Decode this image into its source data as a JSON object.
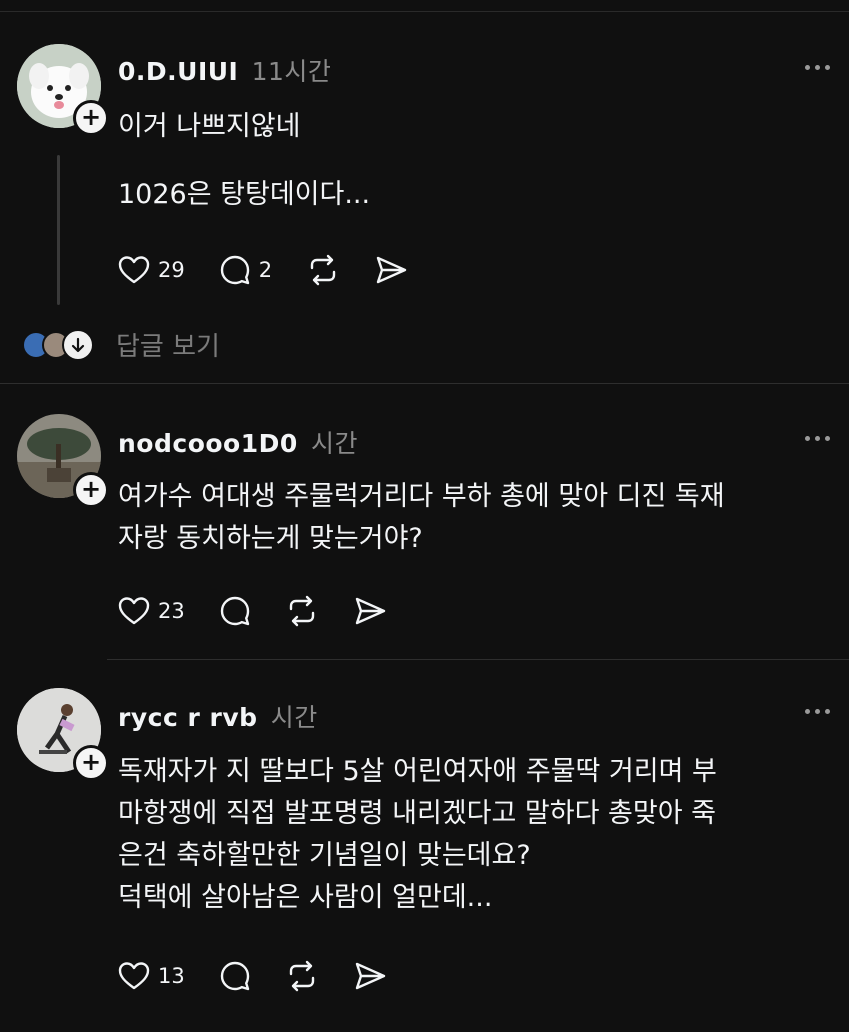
{
  "posts": [
    {
      "username": "0.D.UIUI",
      "time": "11시간",
      "lines": [
        "이거 나쁘지않네",
        "",
        "1026은 탕탕데이다..."
      ],
      "likes": "29",
      "comments": "2",
      "view_replies": "답글 보기"
    },
    {
      "username": "nodcooo1D0",
      "time": "시간",
      "lines": [
        "여가수 여대생 주물럭거리다 부하 총에 맞아 디진 독재",
        "자랑 동치하는게 맞는거야?"
      ],
      "likes": "23"
    },
    {
      "username": "rycc r rvb",
      "time": "시간",
      "lines": [
        "독재자가 지 딸보다 5살 어린여자애 주물딱 거리며 부",
        "마항쟁에 직접 발포명령 내리겠다고 말하다 총맞아 죽",
        "은건 축하할만한 기념일이 맞는데요?",
        "덕택에 살아남은 사람이 얼만데..."
      ],
      "likes": "13"
    }
  ],
  "colors": {
    "background": "#101010",
    "text": "#f3f5f7",
    "muted": "#8a8a8a"
  }
}
